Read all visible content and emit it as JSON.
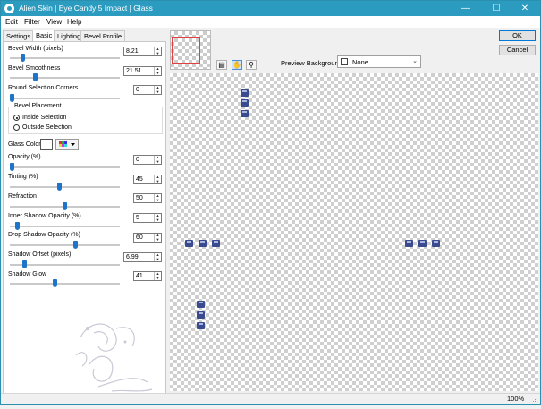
{
  "window": {
    "title": "Alien Skin | Eye Candy 5 Impact | Glass"
  },
  "menu": [
    "Edit",
    "Filter",
    "View",
    "Help"
  ],
  "tabs": [
    "Settings",
    "Basic",
    "Lighting",
    "Bevel Profile"
  ],
  "active_tab": "Basic",
  "controls": {
    "bevel_width": {
      "label": "Bevel Width (pixels)",
      "value": "8.21",
      "level": 0.1
    },
    "bevel_smoothness": {
      "label": "Bevel Smoothness",
      "value": "21.51",
      "level": 0.22
    },
    "round_corners": {
      "label": "Round Selection Corners",
      "value": "0",
      "level": 0.0
    },
    "bevel_placement": {
      "label": "Bevel Placement",
      "inside": "Inside Selection",
      "outside": "Outside Selection",
      "selected": "inside"
    },
    "glass_color": {
      "label": "Glass Color",
      "color": "#ffffff"
    },
    "opacity": {
      "label": "Opacity (%)",
      "value": "0",
      "level": 0.0
    },
    "tinting": {
      "label": "Tinting (%)",
      "value": "45",
      "level": 0.45
    },
    "refraction": {
      "label": "Refraction",
      "value": "50",
      "level": 0.5
    },
    "inner_shadow_opacity": {
      "label": "Inner Shadow Opacity (%)",
      "value": "5",
      "level": 0.05
    },
    "drop_shadow_opacity": {
      "label": "Drop Shadow Opacity (%)",
      "value": "60",
      "level": 0.6
    },
    "shadow_offset": {
      "label": "Shadow Offset (pixels)",
      "value": "6.99",
      "level": 0.12
    },
    "shadow_glow": {
      "label": "Shadow Glow",
      "value": "41",
      "level": 0.41
    }
  },
  "buttons": {
    "ok": "OK",
    "cancel": "Cancel"
  },
  "preview_background": {
    "label": "Preview Background:",
    "value": "None"
  },
  "status": {
    "zoom": "100%"
  },
  "colors": {
    "titlebar": "#2b9bc0",
    "slider_thumb": "#1e74c8",
    "gem": "#3a4a8f"
  }
}
